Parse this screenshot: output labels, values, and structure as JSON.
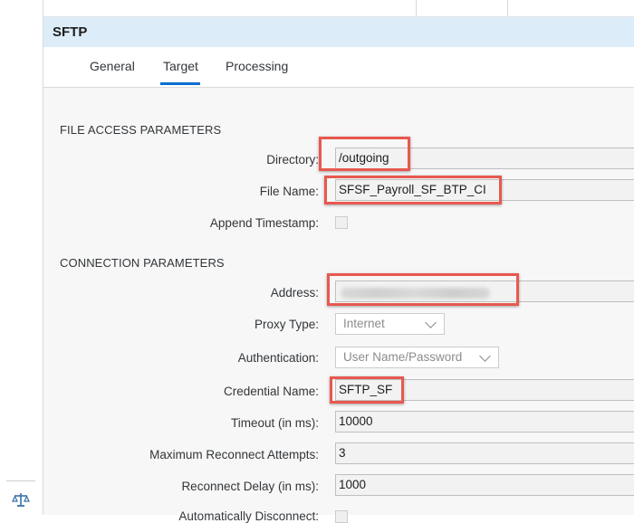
{
  "header": {
    "title": "SFTP"
  },
  "tabs": [
    {
      "label": "General"
    },
    {
      "label": "Target",
      "active": true
    },
    {
      "label": "Processing"
    }
  ],
  "sections": {
    "file_access": "FILE ACCESS PARAMETERS",
    "connection": "CONNECTION PARAMETERS"
  },
  "fields": {
    "directory": {
      "label": "Directory:",
      "value": "/outgoing"
    },
    "file_name": {
      "label": "File Name:",
      "value": "SFSF_Payroll_SF_BTP_CI"
    },
    "append_timestamp": {
      "label": "Append Timestamp:",
      "checked": false
    },
    "address": {
      "label": "Address:",
      "value": ""
    },
    "proxy_type": {
      "label": "Proxy Type:",
      "value": "Internet"
    },
    "authentication": {
      "label": "Authentication:",
      "value": "User Name/Password"
    },
    "credential_name": {
      "label": "Credential Name:",
      "value": "SFTP_SF"
    },
    "timeout": {
      "label": "Timeout (in ms):",
      "value": "10000"
    },
    "max_reconnect": {
      "label": "Maximum Reconnect Attempts:",
      "value": "3"
    },
    "reconnect_delay": {
      "label": "Reconnect Delay (in ms):",
      "value": "1000"
    },
    "auto_disconnect": {
      "label": "Automatically Disconnect:",
      "checked": false
    }
  },
  "colors": {
    "header_bg": "#dcecf9",
    "active_tab_underline": "#0a6ed1",
    "highlight_box": "#e8584f",
    "content_bg": "#f7f7f7"
  },
  "icons": {
    "left_strip": "balance-scale-icon"
  }
}
